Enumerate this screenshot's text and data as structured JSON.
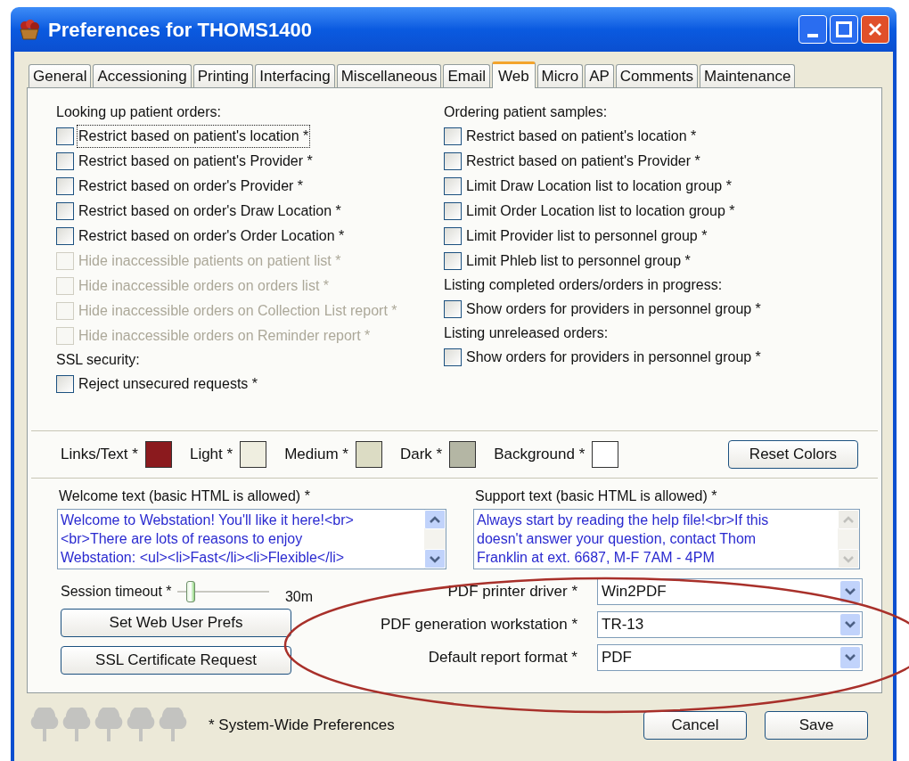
{
  "window": {
    "title": "Preferences for THOMS1400"
  },
  "tabs": [
    {
      "label": "General",
      "selected": false
    },
    {
      "label": "Accessioning",
      "selected": false
    },
    {
      "label": "Printing",
      "selected": false
    },
    {
      "label": "Interfacing",
      "selected": false
    },
    {
      "label": "Miscellaneous",
      "selected": false
    },
    {
      "label": "Email",
      "selected": false
    },
    {
      "label": "Web",
      "selected": true
    },
    {
      "label": "Micro",
      "selected": false
    },
    {
      "label": "AP",
      "selected": false
    },
    {
      "label": "Comments",
      "selected": false
    },
    {
      "label": "Maintenance",
      "selected": false
    }
  ],
  "left_groups": [
    {
      "heading": "Looking up patient orders:",
      "options": [
        {
          "label": "Restrict based on patient's location *",
          "checked": false,
          "disabled": false,
          "focused": true
        },
        {
          "label": "Restrict based on patient's Provider *",
          "checked": false,
          "disabled": false,
          "focused": false
        },
        {
          "label": "Restrict based on order's Provider *",
          "checked": false,
          "disabled": false,
          "focused": false
        },
        {
          "label": "Restrict based on order's Draw Location *",
          "checked": false,
          "disabled": false,
          "focused": false
        },
        {
          "label": "Restrict based on order's Order Location *",
          "checked": false,
          "disabled": false,
          "focused": false
        },
        {
          "label": "Hide inaccessible patients on patient list *",
          "checked": false,
          "disabled": true,
          "focused": false
        },
        {
          "label": "Hide inaccessible orders on orders list *",
          "checked": false,
          "disabled": true,
          "focused": false
        },
        {
          "label": "Hide inaccessible orders on Collection List report *",
          "checked": false,
          "disabled": true,
          "focused": false
        },
        {
          "label": "Hide inaccessible orders on Reminder report *",
          "checked": false,
          "disabled": true,
          "focused": false
        }
      ]
    },
    {
      "heading": "SSL security:",
      "options": [
        {
          "label": "Reject unsecured requests *",
          "checked": false,
          "disabled": false,
          "focused": false
        }
      ]
    }
  ],
  "right_groups": [
    {
      "heading": "Ordering patient samples:",
      "options": [
        {
          "label": "Restrict based on patient's location *",
          "checked": false,
          "disabled": false,
          "focused": false
        },
        {
          "label": "Restrict based on patient's Provider *",
          "checked": false,
          "disabled": false,
          "focused": false
        },
        {
          "label": "Limit Draw Location list to location group *",
          "checked": false,
          "disabled": false,
          "focused": false
        },
        {
          "label": "Limit Order Location list to location group *",
          "checked": false,
          "disabled": false,
          "focused": false
        },
        {
          "label": "Limit Provider list to personnel group *",
          "checked": false,
          "disabled": false,
          "focused": false
        },
        {
          "label": "Limit Phleb list to personnel group *",
          "checked": false,
          "disabled": false,
          "focused": false
        }
      ]
    },
    {
      "heading": "Listing completed orders/orders in progress:",
      "options": [
        {
          "label": "Show orders for providers in personnel group *",
          "checked": false,
          "disabled": false,
          "focused": false
        }
      ]
    },
    {
      "heading": "Listing unreleased orders:",
      "options": [
        {
          "label": "Show orders for providers in personnel group *",
          "checked": false,
          "disabled": false,
          "focused": false
        }
      ]
    }
  ],
  "colors": [
    {
      "label": "Links/Text *",
      "color": "#8b1a1e"
    },
    {
      "label": "Light *",
      "color": "#efeee0"
    },
    {
      "label": "Medium *",
      "color": "#dcdcc4"
    },
    {
      "label": "Dark *",
      "color": "#b4b6a4"
    },
    {
      "label": "Background *",
      "color": "#ffffff"
    }
  ],
  "reset_button": "Reset Colors",
  "text_fields": [
    {
      "label": "Welcome text (basic HTML is allowed) *",
      "value": "Welcome to Webstation! You'll like it here!<br>\n<br>There are lots of reasons to enjoy\nWebstation: <ul><li>Fast</li><li>Flexible</li>",
      "scroll_enabled": true
    },
    {
      "label": "Support text (basic HTML is allowed) *",
      "value": "Always start by reading the help file!<br>If this\ndoesn't answer your question, contact Thom\nFranklin at ext. 6687, M-F 7AM - 4PM",
      "scroll_enabled": false
    }
  ],
  "session_timeout": {
    "label": "Session timeout *",
    "level": 0.1,
    "reading": "30m"
  },
  "action_buttons": [
    "Set Web User Prefs",
    "SSL Certificate Request"
  ],
  "pdf_fields": [
    {
      "label": "PDF printer driver *",
      "value": "Win2PDF"
    },
    {
      "label": "PDF generation workstation *",
      "value": "TR-13"
    },
    {
      "label": "Default report format *",
      "value": "PDF"
    }
  ],
  "footer_note": "* System-Wide Preferences",
  "dialog_buttons": [
    "Cancel",
    "Save"
  ]
}
